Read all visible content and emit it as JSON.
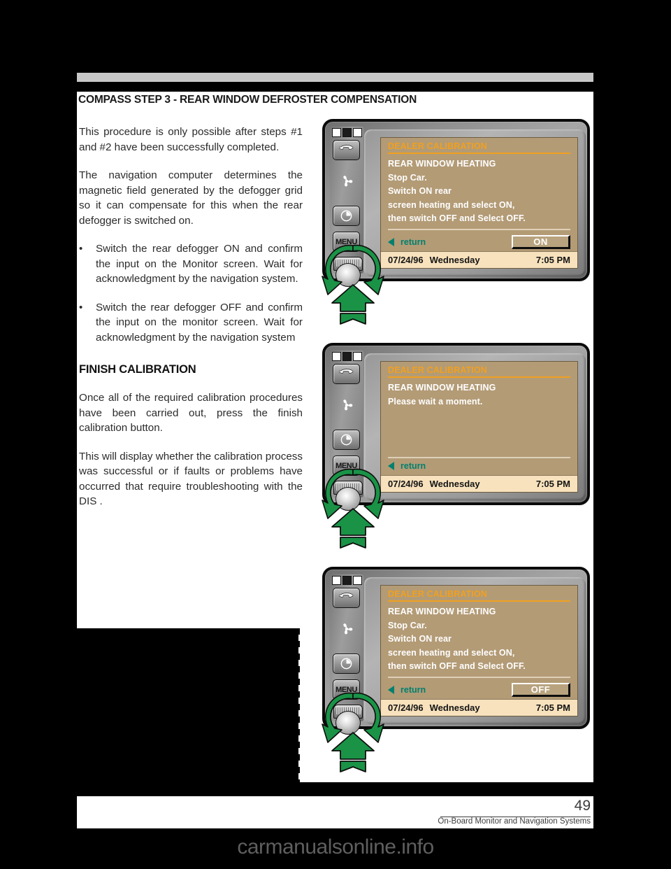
{
  "document": {
    "page_title": "COMPASS STEP 3 - REAR WINDOW DEFROSTER COMPENSATION",
    "page_number": "49",
    "footer_subtitle": "On-Board Monitor and Navigation Systems",
    "watermark": "carmanualsonline.info"
  },
  "body": {
    "paragraph1": "This procedure is only possible after steps #1 and #2 have been successfully completed.",
    "paragraph2": "The navigation computer determines the magnetic field generated by the defogger grid so it can compensate for this when the rear defogger is switched on.",
    "bullet_marker": "•",
    "bullet1": "Switch the rear defogger ON and confirm the input on the Monitor screen. Wait for acknowledgment by the navigation system.",
    "bullet2": "Switch the rear defogger OFF and confirm the input on the monitor screen. Wait for acknowledgment by the navigation system",
    "section_heading": "FINISH CALIBRATION",
    "paragraph3": "Once all of the required calibration procedures have been carried out, press the finish calibration button.",
    "paragraph4": "This will display whether the calibration process was successful or if faults or problems have occurred that require troubleshooting with the DIS ."
  },
  "monitor_controls": {
    "phone_icon": "phone-handset-icon",
    "fan_icon": "fan-snowflake-icon",
    "clock_icon": "clock-icon",
    "menu_label": "MENU",
    "knob_icon": "rotary-knob",
    "led_states": [
      "on",
      "off",
      "on"
    ]
  },
  "screens": [
    {
      "id": "screen-on",
      "title": "DEALER CALIBRATION",
      "lines": [
        "REAR WINDOW HEATING",
        "Stop Car.",
        "Switch ON rear",
        "screen heating and select ON,",
        "then switch OFF and Select OFF."
      ],
      "return_label": "return",
      "option_button": "ON",
      "has_option_button": true,
      "status": {
        "date": "07/24/96",
        "day": "Wednesday",
        "time": "7:05 PM"
      }
    },
    {
      "id": "screen-wait",
      "title": "DEALER CALIBRATION",
      "lines": [
        "REAR WINDOW HEATING",
        "Please wait a moment."
      ],
      "return_label": "return",
      "option_button": "",
      "has_option_button": false,
      "status": {
        "date": "07/24/96",
        "day": "Wednesday",
        "time": "7:05 PM"
      }
    },
    {
      "id": "screen-off",
      "title": "DEALER CALIBRATION",
      "lines": [
        "REAR WINDOW HEATING",
        "Stop Car.",
        "Switch ON rear",
        "screen heating and select ON,",
        "then switch OFF and Select OFF."
      ],
      "return_label": "return",
      "option_button": "OFF",
      "has_option_button": true,
      "status": {
        "date": "07/24/96",
        "day": "Wednesday",
        "time": "7:05 PM"
      }
    }
  ],
  "colors": {
    "screen_background": "#b39b76",
    "screen_title": "#f0a020",
    "screen_text": "#ffffff",
    "status_bar": "#f7e2bd",
    "return_teal": "#00806e",
    "arrow_green": "#1a9347",
    "page_background": "#000000",
    "rule_gray": "#c8c8c8"
  },
  "annotations": {
    "press_knob_arrow": "press-knob-up-arrow",
    "rotate_knob_arrow": "rotate-knob-circular-arrow"
  }
}
